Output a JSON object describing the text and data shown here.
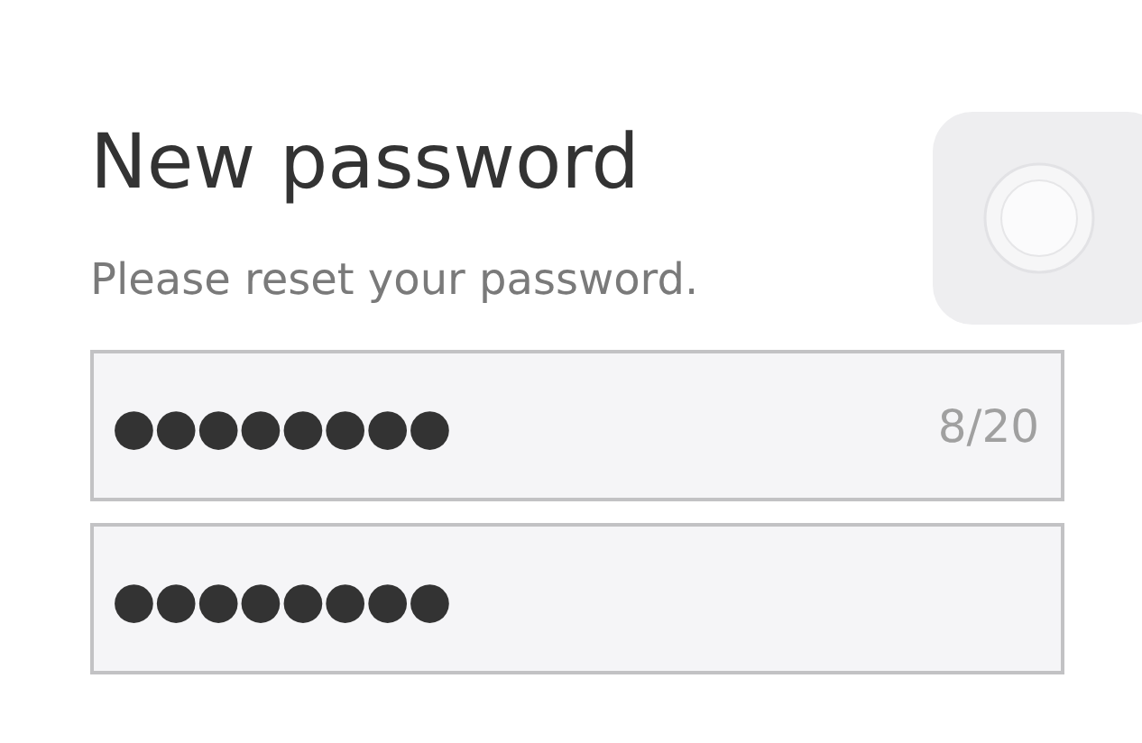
{
  "title": "New password",
  "subtitle": "Please reset your password.",
  "fields": [
    {
      "value": "●●●●●●●●",
      "counter": "8/20"
    },
    {
      "value": "●●●●●●●●"
    }
  ]
}
